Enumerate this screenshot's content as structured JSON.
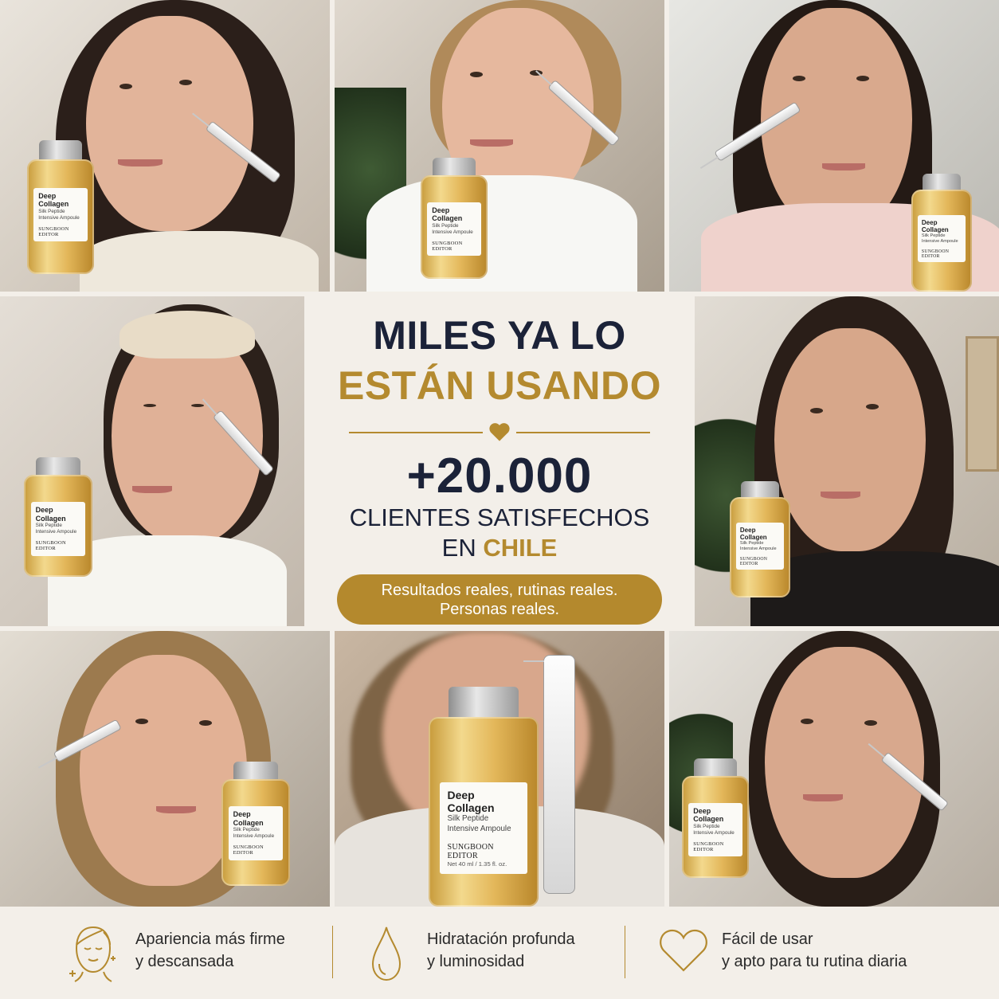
{
  "headline": {
    "line1": "MILES YA LO",
    "line2": "ESTÁN USANDO",
    "count": "+20.000",
    "sub_line1": "CLIENTES SATISFECHOS",
    "sub_line2_prefix": "EN ",
    "sub_line2_highlight": "CHILE",
    "pill_line1": "Resultados reales, rutinas reales.",
    "pill_line2": "Personas reales."
  },
  "product": {
    "name": "Deep Collagen",
    "line2": "Silk Peptide",
    "line3": "Intensive Ampoule",
    "brand": "SUNGBOON EDITOR",
    "volume": "Net 40 ml / 1.35 fl. oz."
  },
  "features": [
    {
      "icon": "face-sparkle-icon",
      "line1": "Apariencia más firme",
      "line2": "y descansada"
    },
    {
      "icon": "water-drop-icon",
      "line1": "Hidratación profunda",
      "line2": "y luminosidad"
    },
    {
      "icon": "heart-outline-icon",
      "line1": "Fácil de usar",
      "line2": "y apto para tu rutina diaria"
    }
  ],
  "colors": {
    "navy": "#1b2238",
    "gold": "#b48a2f",
    "background": "#f3efe9"
  }
}
